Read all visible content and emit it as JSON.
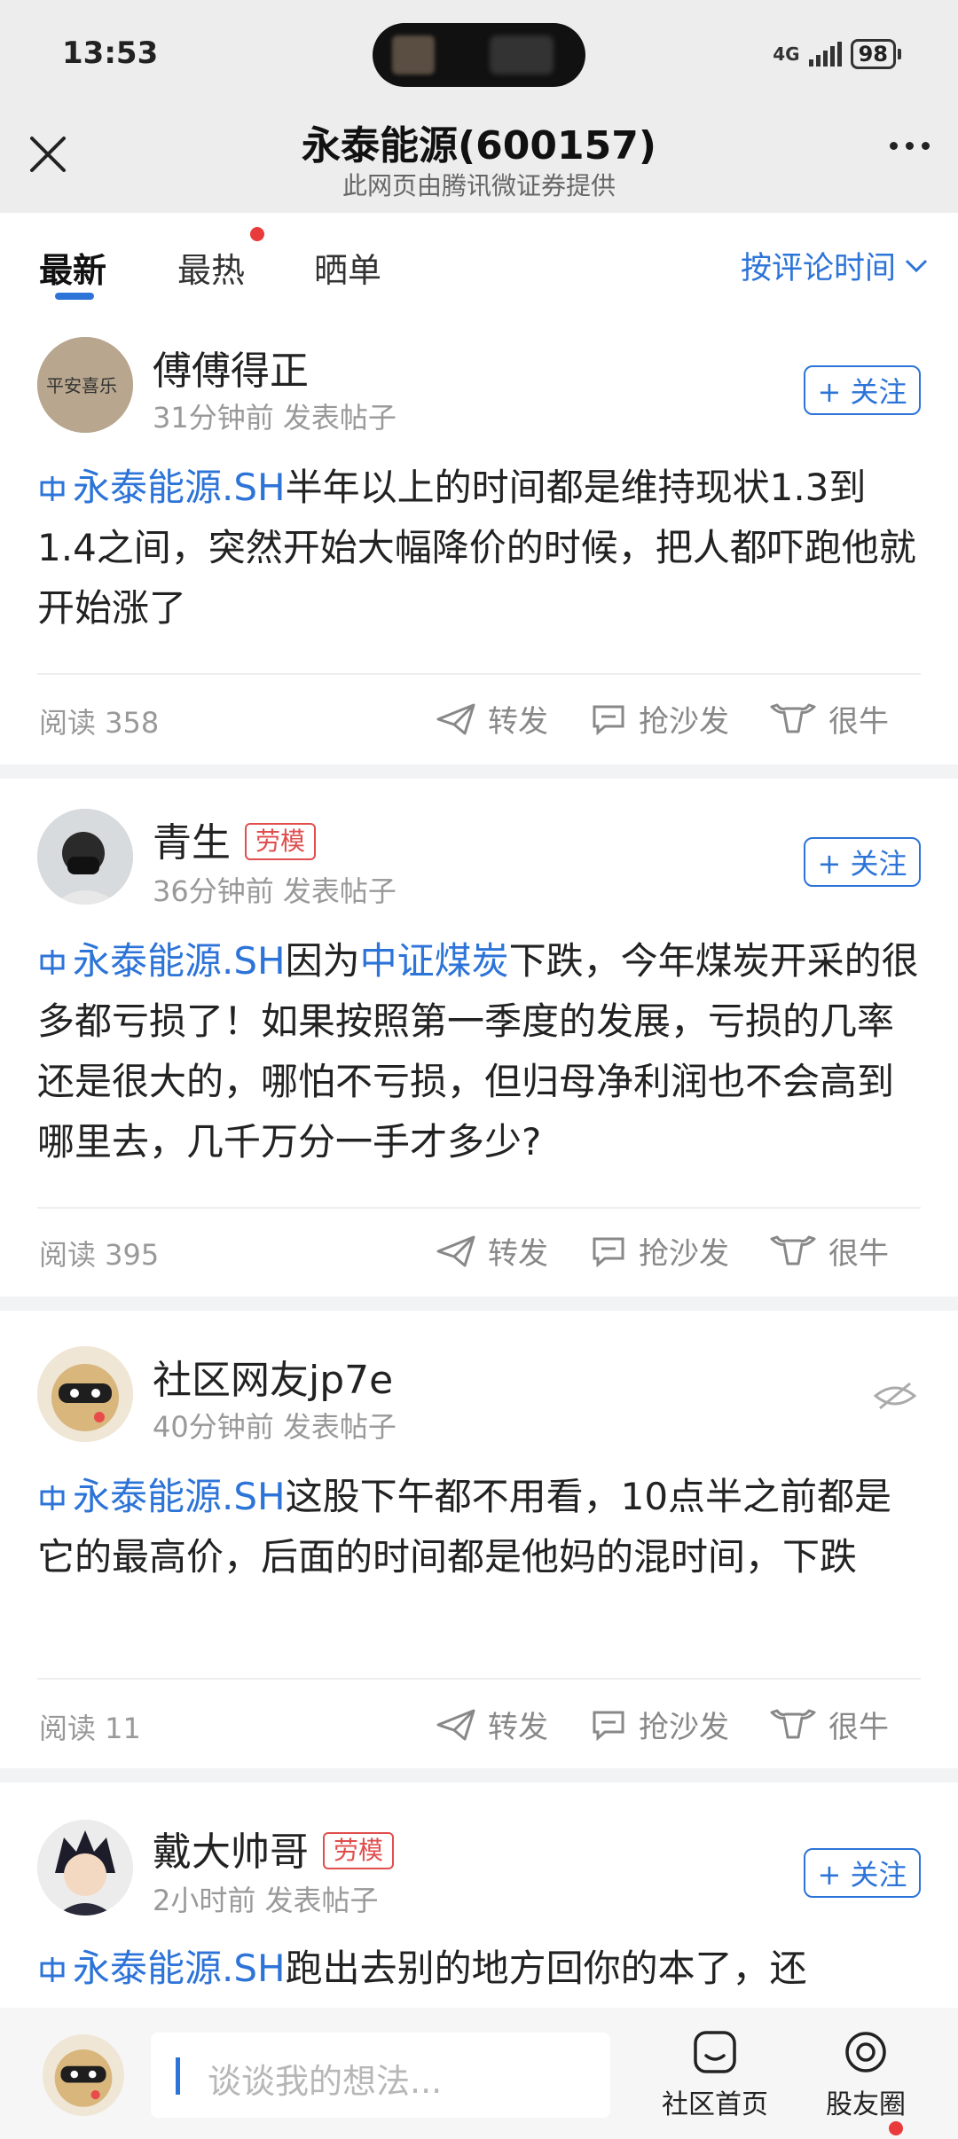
{
  "status_bar": {
    "time": "13:53",
    "network": "4G",
    "battery": "98"
  },
  "header": {
    "title": "永泰能源(600157)",
    "subtitle": "此网页由腾讯微证券提供"
  },
  "tabs": [
    {
      "label": "最新",
      "active": true
    },
    {
      "label": "最热",
      "has_dot": true
    },
    {
      "label": "晒单"
    }
  ],
  "sort_label": "按评论时间",
  "posts": [
    {
      "username": "傅傅得正",
      "meta": "31分钟前 发表帖子",
      "follow_label": "+ 关注",
      "stock": "永泰能源.SH",
      "text": "半年以上的时间都是维持现状1.3到1.4之间，突然开始大幅降价的时候，把人都吓跑他就开始涨了",
      "reads": "阅读 358",
      "actions": [
        "转发",
        "抢沙发",
        "很牛"
      ]
    },
    {
      "username": "青生",
      "badge": "劳模",
      "meta": "36分钟前 发表帖子",
      "follow_label": "+ 关注",
      "stock": "永泰能源.SH",
      "text_before": "因为",
      "linked_term": "中证煤炭",
      "text": "下跌，今年煤炭开采的很多都亏损了！如果按照第一季度的发展，亏损的几率还是很大的，哪怕不亏损，但归母净利润也不会高到哪里去，几千万分一手才多少?",
      "reads": "阅读 395",
      "actions": [
        "转发",
        "抢沙发",
        "很牛"
      ]
    },
    {
      "username": "社区网友jp7e",
      "meta": "40分钟前 发表帖子",
      "stock": "永泰能源.SH",
      "text": "这股下午都不用看，10点半之前都是它的最高价，后面的时间都是他妈的混时间，下跌",
      "reads": "阅读 11",
      "actions": [
        "转发",
        "抢沙发",
        "很牛"
      ]
    },
    {
      "username": "戴大帅哥",
      "badge": "劳模",
      "meta": "2小时前 发表帖子",
      "follow_label": "+ 关注",
      "stock": "永泰能源.SH",
      "text": "跑出去别的地方回你的本了，还"
    }
  ],
  "bottom_bar": {
    "comment_placeholder": "谈谈我的想法...",
    "nav": [
      {
        "label": "社区首页"
      },
      {
        "label": "股友圈",
        "has_dot": true
      }
    ]
  },
  "colors": {
    "accent": "#2d74d8",
    "badge": "#e04e4e",
    "meta": "#999999",
    "header_bg": "#ededed"
  }
}
